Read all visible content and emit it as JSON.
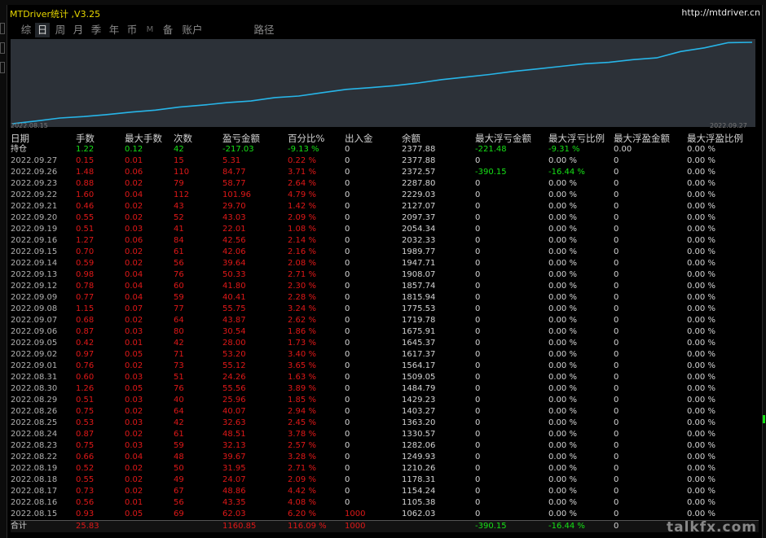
{
  "window": {
    "title": "MTDriver统计 ,V3.25",
    "url": "http://mtdriver.cn"
  },
  "tabs": [
    {
      "label": "综",
      "active": false
    },
    {
      "label": "日",
      "active": true
    },
    {
      "label": "周",
      "active": false
    },
    {
      "label": "月",
      "active": false
    },
    {
      "label": "季",
      "active": false
    },
    {
      "label": "年",
      "active": false
    },
    {
      "label": "币",
      "active": false
    },
    {
      "label": "M",
      "active": false
    },
    {
      "label": "备",
      "active": false
    },
    {
      "label": "账户",
      "active": false
    },
    {
      "label": "路径",
      "active": false
    }
  ],
  "chart_data": {
    "type": "line",
    "x_start_label": "2022.08.15",
    "x_end_label": "2022.09.27",
    "series": [
      {
        "color": "#27b5e8",
        "x": [
          "2022.08.15",
          "2022.08.16",
          "2022.08.17",
          "2022.08.18",
          "2022.08.19",
          "2022.08.22",
          "2022.08.23",
          "2022.08.24",
          "2022.08.25",
          "2022.08.26",
          "2022.08.29",
          "2022.08.30",
          "2022.08.31",
          "2022.09.01",
          "2022.09.02",
          "2022.09.05",
          "2022.09.06",
          "2022.09.07",
          "2022.09.08",
          "2022.09.09",
          "2022.09.12",
          "2022.09.13",
          "2022.09.14",
          "2022.09.15",
          "2022.09.16",
          "2022.09.19",
          "2022.09.20",
          "2022.09.21",
          "2022.09.22",
          "2022.09.23",
          "2022.09.26",
          "2022.09.27"
        ],
        "values": [
          1062.03,
          1105.38,
          1154.24,
          1178.31,
          1210.26,
          1249.93,
          1282.06,
          1330.57,
          1363.2,
          1403.27,
          1429.23,
          1484.79,
          1509.05,
          1564.17,
          1617.37,
          1645.37,
          1675.91,
          1719.78,
          1775.53,
          1815.94,
          1857.74,
          1908.07,
          1947.71,
          1989.77,
          2032.33,
          2054.34,
          2097.37,
          2127.07,
          2229.03,
          2287.8,
          2372.57,
          2377.88
        ]
      }
    ]
  },
  "table": {
    "headers": [
      "日期",
      "手数",
      "最大手数",
      "次数",
      "盈亏金额",
      "百分比%",
      "出入金",
      "余额",
      "最大浮亏金额",
      "最大浮亏比例",
      "最大浮盈金额",
      "最大浮盈比例"
    ],
    "hold_row": [
      "持仓",
      "1.22",
      "0.12",
      "42",
      "-217.03",
      "-9.13 %",
      "0",
      "2377.88",
      "-221.48",
      "-9.31 %",
      "0.00",
      "0.00 %"
    ],
    "rows": [
      [
        "2022.09.27",
        "0.15",
        "0.01",
        "15",
        "5.31",
        "0.22 %",
        "0",
        "2377.88",
        "0",
        "0.00 %",
        "0",
        "0.00 %"
      ],
      [
        "2022.09.26",
        "1.48",
        "0.06",
        "110",
        "84.77",
        "3.71 %",
        "0",
        "2372.57",
        "-390.15",
        "-16.44 %",
        "0",
        "0.00 %"
      ],
      [
        "2022.09.23",
        "0.88",
        "0.02",
        "79",
        "58.77",
        "2.64 %",
        "0",
        "2287.80",
        "0",
        "0.00 %",
        "0",
        "0.00 %"
      ],
      [
        "2022.09.22",
        "1.60",
        "0.04",
        "112",
        "101.96",
        "4.79 %",
        "0",
        "2229.03",
        "0",
        "0.00 %",
        "0",
        "0.00 %"
      ],
      [
        "2022.09.21",
        "0.46",
        "0.02",
        "43",
        "29.70",
        "1.42 %",
        "0",
        "2127.07",
        "0",
        "0.00 %",
        "0",
        "0.00 %"
      ],
      [
        "2022.09.20",
        "0.55",
        "0.02",
        "52",
        "43.03",
        "2.09 %",
        "0",
        "2097.37",
        "0",
        "0.00 %",
        "0",
        "0.00 %"
      ],
      [
        "2022.09.19",
        "0.51",
        "0.03",
        "41",
        "22.01",
        "1.08 %",
        "0",
        "2054.34",
        "0",
        "0.00 %",
        "0",
        "0.00 %"
      ],
      [
        "2022.09.16",
        "1.27",
        "0.06",
        "84",
        "42.56",
        "2.14 %",
        "0",
        "2032.33",
        "0",
        "0.00 %",
        "0",
        "0.00 %"
      ],
      [
        "2022.09.15",
        "0.70",
        "0.02",
        "61",
        "42.06",
        "2.16 %",
        "0",
        "1989.77",
        "0",
        "0.00 %",
        "0",
        "0.00 %"
      ],
      [
        "2022.09.14",
        "0.59",
        "0.02",
        "56",
        "39.64",
        "2.08 %",
        "0",
        "1947.71",
        "0",
        "0.00 %",
        "0",
        "0.00 %"
      ],
      [
        "2022.09.13",
        "0.98",
        "0.04",
        "76",
        "50.33",
        "2.71 %",
        "0",
        "1908.07",
        "0",
        "0.00 %",
        "0",
        "0.00 %"
      ],
      [
        "2022.09.12",
        "0.78",
        "0.04",
        "60",
        "41.80",
        "2.30 %",
        "0",
        "1857.74",
        "0",
        "0.00 %",
        "0",
        "0.00 %"
      ],
      [
        "2022.09.09",
        "0.77",
        "0.04",
        "59",
        "40.41",
        "2.28 %",
        "0",
        "1815.94",
        "0",
        "0.00 %",
        "0",
        "0.00 %"
      ],
      [
        "2022.09.08",
        "1.15",
        "0.07",
        "77",
        "55.75",
        "3.24 %",
        "0",
        "1775.53",
        "0",
        "0.00 %",
        "0",
        "0.00 %"
      ],
      [
        "2022.09.07",
        "0.68",
        "0.02",
        "64",
        "43.87",
        "2.62 %",
        "0",
        "1719.78",
        "0",
        "0.00 %",
        "0",
        "0.00 %"
      ],
      [
        "2022.09.06",
        "0.87",
        "0.03",
        "80",
        "30.54",
        "1.86 %",
        "0",
        "1675.91",
        "0",
        "0.00 %",
        "0",
        "0.00 %"
      ],
      [
        "2022.09.05",
        "0.42",
        "0.01",
        "42",
        "28.00",
        "1.73 %",
        "0",
        "1645.37",
        "0",
        "0.00 %",
        "0",
        "0.00 %"
      ],
      [
        "2022.09.02",
        "0.97",
        "0.05",
        "71",
        "53.20",
        "3.40 %",
        "0",
        "1617.37",
        "0",
        "0.00 %",
        "0",
        "0.00 %"
      ],
      [
        "2022.09.01",
        "0.76",
        "0.02",
        "73",
        "55.12",
        "3.65 %",
        "0",
        "1564.17",
        "0",
        "0.00 %",
        "0",
        "0.00 %"
      ],
      [
        "2022.08.31",
        "0.60",
        "0.03",
        "51",
        "24.26",
        "1.63 %",
        "0",
        "1509.05",
        "0",
        "0.00 %",
        "0",
        "0.00 %"
      ],
      [
        "2022.08.30",
        "1.26",
        "0.05",
        "76",
        "55.56",
        "3.89 %",
        "0",
        "1484.79",
        "0",
        "0.00 %",
        "0",
        "0.00 %"
      ],
      [
        "2022.08.29",
        "0.51",
        "0.03",
        "40",
        "25.96",
        "1.85 %",
        "0",
        "1429.23",
        "0",
        "0.00 %",
        "0",
        "0.00 %"
      ],
      [
        "2022.08.26",
        "0.75",
        "0.02",
        "64",
        "40.07",
        "2.94 %",
        "0",
        "1403.27",
        "0",
        "0.00 %",
        "0",
        "0.00 %"
      ],
      [
        "2022.08.25",
        "0.53",
        "0.03",
        "42",
        "32.63",
        "2.45 %",
        "0",
        "1363.20",
        "0",
        "0.00 %",
        "0",
        "0.00 %"
      ],
      [
        "2022.08.24",
        "0.87",
        "0.02",
        "61",
        "48.51",
        "3.78 %",
        "0",
        "1330.57",
        "0",
        "0.00 %",
        "0",
        "0.00 %"
      ],
      [
        "2022.08.23",
        "0.75",
        "0.03",
        "59",
        "32.13",
        "2.57 %",
        "0",
        "1282.06",
        "0",
        "0.00 %",
        "0",
        "0.00 %"
      ],
      [
        "2022.08.22",
        "0.66",
        "0.04",
        "48",
        "39.67",
        "3.28 %",
        "0",
        "1249.93",
        "0",
        "0.00 %",
        "0",
        "0.00 %"
      ],
      [
        "2022.08.19",
        "0.52",
        "0.02",
        "50",
        "31.95",
        "2.71 %",
        "0",
        "1210.26",
        "0",
        "0.00 %",
        "0",
        "0.00 %"
      ],
      [
        "2022.08.18",
        "0.55",
        "0.02",
        "49",
        "24.07",
        "2.09 %",
        "0",
        "1178.31",
        "0",
        "0.00 %",
        "0",
        "0.00 %"
      ],
      [
        "2022.08.17",
        "0.73",
        "0.02",
        "67",
        "48.86",
        "4.42 %",
        "0",
        "1154.24",
        "0",
        "0.00 %",
        "0",
        "0.00 %"
      ],
      [
        "2022.08.16",
        "0.56",
        "0.01",
        "56",
        "43.35",
        "4.08 %",
        "0",
        "1105.38",
        "0",
        "0.00 %",
        "0",
        "0.00 %"
      ],
      [
        "2022.08.15",
        "0.93",
        "0.05",
        "69",
        "62.03",
        "6.20 %",
        "1000",
        "1062.03",
        "0",
        "0.00 %",
        "0",
        "0.00 %"
      ]
    ],
    "total_row": [
      "合计",
      "25.83",
      "",
      "",
      "1160.85",
      "116.09 %",
      "1000",
      "",
      "-390.15",
      "-16.44 %",
      "0",
      ""
    ]
  },
  "watermark": "talkfx.com",
  "colors": {
    "positive": "#e01818",
    "negative": "#16e016",
    "line": "#27b5e8",
    "chart_bg": "#2c3138"
  }
}
